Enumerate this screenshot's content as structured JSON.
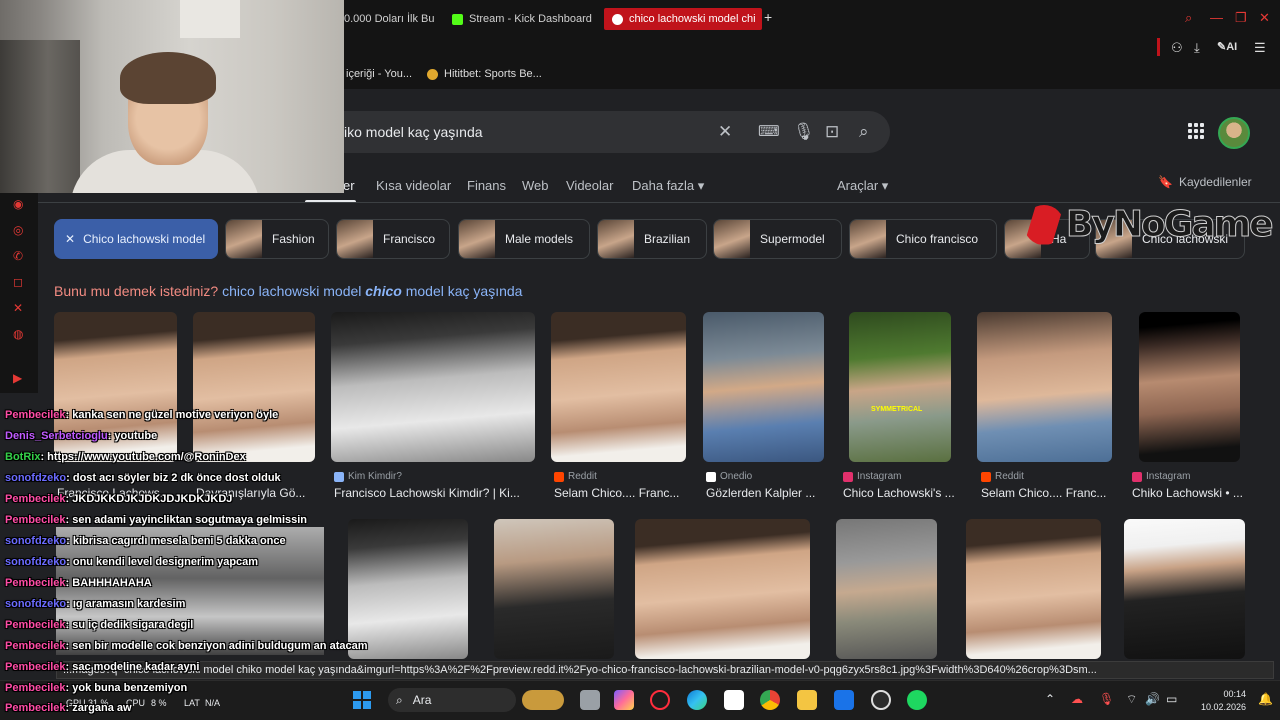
{
  "browser": {
    "tabs": [
      {
        "label": "0.000 Doları İlk Bu",
        "active": false
      },
      {
        "label": "Stream - Kick Dashboard",
        "active": false
      },
      {
        "label": "chico lachowski model chi",
        "active": true
      }
    ],
    "new_tab": "+",
    "bookmarks": [
      "içeriği - You...",
      "Hititbet: Sports Be..."
    ],
    "ai_label": "AI"
  },
  "search": {
    "query": "iko model kaç yaşında",
    "nav_tabs": [
      "er",
      "Kısa videolar",
      "Finans",
      "Web",
      "Videolar",
      "Daha fazla ▾"
    ],
    "tools": "Araçlar ▾",
    "saved": "Kaydedilenler"
  },
  "chips": [
    {
      "label": "Chico lachowski model",
      "selected": true
    },
    {
      "label": "Fashion"
    },
    {
      "label": "Francisco"
    },
    {
      "label": "Male models"
    },
    {
      "label": "Brazilian"
    },
    {
      "label": "Supermodel"
    },
    {
      "label": "Chico francisco"
    },
    {
      "label": "Ha"
    },
    {
      "label": "Chico lachowski"
    }
  ],
  "did_you_mean": {
    "label": "Bunu mu demek istediniz?",
    "pre": "chico lachowski model ",
    "bold": "chico",
    "post": " model kaç yaşında"
  },
  "results_row1": [
    {
      "source": "",
      "caption": "Francisco Lachows..."
    },
    {
      "source": "",
      "caption": "Davranışlarıyla Gö..."
    },
    {
      "source": "Kim Kimdir?",
      "caption": "Francisco Lachowski Kimdir? | Ki..."
    },
    {
      "source": "Reddit",
      "caption": "Selam Chico.... Franc..."
    },
    {
      "source": "Onedio",
      "caption": "Gözlerden Kalpler ..."
    },
    {
      "source": "Instagram",
      "caption": "Chico Lachowski's ..."
    },
    {
      "source": "Reddit",
      "caption": "Selam Chico.... Franc..."
    },
    {
      "source": "Instagram",
      "caption": "Chiko Lachowski • ..."
    }
  ],
  "image_texts": {
    "symmetrical": "SYMMETRICAL"
  },
  "watermark": "ByNoGame",
  "chat": [
    {
      "user": "Pembecilek",
      "msg": ": kanka sen ne güzel motive veriyon öyle",
      "color": "pink"
    },
    {
      "user": "Denis_Serbetcioglu",
      "msg": ": youtube",
      "color": "purple"
    },
    {
      "user": "BotRix",
      "msg": ": https://www.youtube.com/@RoninDex",
      "color": "green"
    },
    {
      "user": "sonofdzeko",
      "msg": ": dost acı söyler biz 2 dk önce dost olduk",
      "color": "blue"
    },
    {
      "user": "Pembecilek",
      "msg": ": JKDJKKDJKJDKJDJKDKJKDJ",
      "color": "pink"
    },
    {
      "user": "Pembecilek",
      "msg": ": sen adami yayincliktan sogutmaya gelmissin",
      "color": "pink"
    },
    {
      "user": "sonofdzeko",
      "msg": ": kibrisa cagırdı mesela beni 5 dakka once",
      "color": "blue"
    },
    {
      "user": "sonofdzeko",
      "msg": ": onu kendi level designerim yapcam",
      "color": "blue"
    },
    {
      "user": "Pembecilek",
      "msg": ": BAHHHAHAHA",
      "color": "pink"
    },
    {
      "user": "sonofdzeko",
      "msg": ": ıg aramasın kardesim",
      "color": "blue"
    },
    {
      "user": "Pembecilek",
      "msg": ": su iç dedik sigara degil",
      "color": "pink"
    },
    {
      "user": "Pembecilek",
      "msg": ": sen bir modelle cok benziyon adini buldugum an atacam",
      "color": "pink"
    },
    {
      "user": "Pembecilek",
      "msg": ": sac modeline kadar ayni",
      "color": "pink"
    },
    {
      "user": "Pembecilek",
      "msg": ": yok buna benzemiyon",
      "color": "pink"
    },
    {
      "user": "Pembecilek",
      "msg": ": zargana aw",
      "color": "pink"
    }
  ],
  "status_url": "...mages?q=chico lachowski model chiko model kaç yaşında&imgurl=https%3A%2F%2Fpreview.redd.it%2Fyo-chico-francisco-lachowski-brazilian-model-v0-pqg6zyx5rs8c1.jpg%3Fwidth%3D640%26crop%3Dsm...",
  "taskbar": {
    "gpu": "GPU 31 %",
    "cpu": "CPU",
    "cpu_val": "8 %",
    "lat": "LAT",
    "lat_val": "N/A",
    "search_label": "Ara",
    "time": "00:14",
    "date": "10.02.2026"
  }
}
